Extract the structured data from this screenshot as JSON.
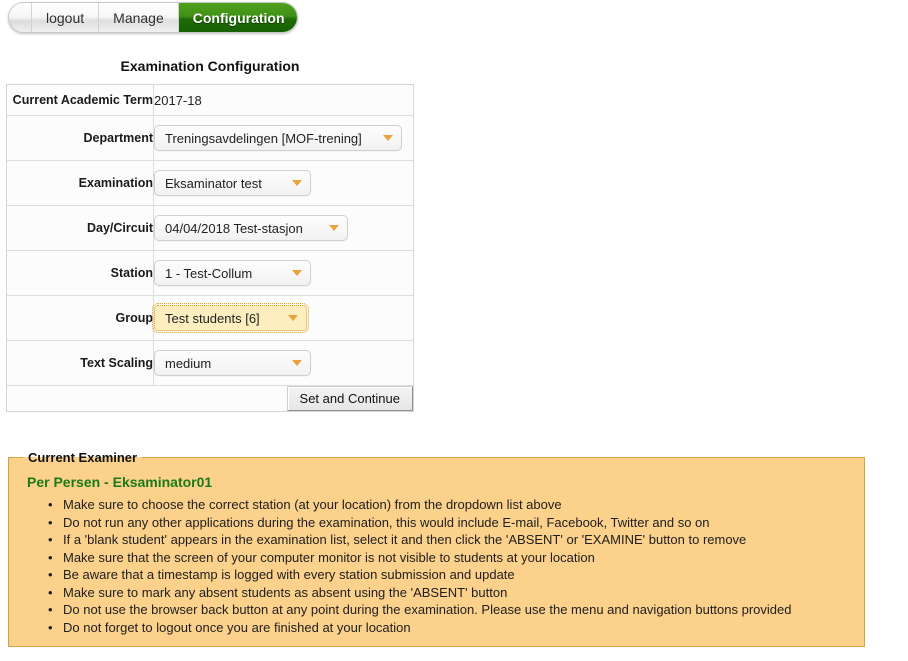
{
  "nav": {
    "tabs": [
      {
        "label": "logout",
        "active": false
      },
      {
        "label": "Manage",
        "active": false
      },
      {
        "label": "Configuration",
        "active": true
      }
    ]
  },
  "page": {
    "title": "Examination Configuration"
  },
  "form": {
    "rows": [
      {
        "label": "Current Academic Term",
        "type": "text",
        "value": "2017-18"
      },
      {
        "label": "Department",
        "type": "select",
        "value": "Treningsavdelingen [MOF-trening]",
        "focused": false
      },
      {
        "label": "Examination",
        "type": "select",
        "value": "Eksaminator test",
        "focused": false
      },
      {
        "label": "Day/Circuit",
        "type": "select",
        "value": "04/04/2018 Test-stasjon",
        "focused": false
      },
      {
        "label": "Station",
        "type": "select",
        "value": "1 - Test-Collum",
        "focused": false
      },
      {
        "label": "Group",
        "type": "select",
        "value": "Test students [6]",
        "focused": true
      },
      {
        "label": "Text Scaling",
        "type": "select",
        "value": "medium",
        "focused": false
      }
    ],
    "submit_label": "Set and Continue"
  },
  "examiner": {
    "legend": "Current Examiner",
    "name": "Per Persen - Eksaminator01",
    "notes": [
      "Make sure to choose the correct station (at your location) from the dropdown list above",
      "Do not run any other applications during the examination, this would include E-mail, Facebook, Twitter and so on",
      "If a 'blank student' appears in the examination list, select it and then click the 'ABSENT' or 'EXAMINE' button to remove",
      "Make sure that the screen of your computer monitor is not visible to students at your location",
      "Be aware that a timestamp is logged with every station submission and update",
      "Make sure to mark any absent students as absent using the 'ABSENT' button",
      "Do not use the browser back button at any point during the examination. Please use the menu and navigation buttons provided",
      "Do not forget to logout once you are finished at your location"
    ]
  },
  "colors": {
    "active_tab_green": "#3f9116",
    "examiner_panel_bg": "#fcd18b",
    "examiner_panel_border": "#cfa243",
    "examiner_name_green": "#1a7a1a",
    "caret_orange": "#e8a33d",
    "focus_outline": "#d8a017"
  }
}
